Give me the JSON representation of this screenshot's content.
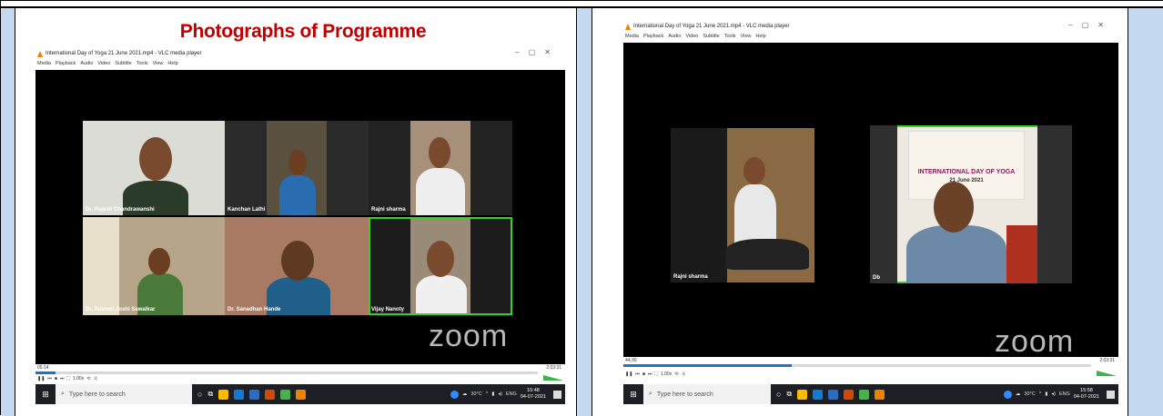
{
  "heading": "Photographs of Programme",
  "left_window": {
    "title": "International Day of Yoga 21 June 2021.mp4 - VLC media player",
    "menu": [
      "Media",
      "Playback",
      "Audio",
      "Video",
      "Subtitle",
      "Tools",
      "View",
      "Help"
    ],
    "participants": [
      {
        "name": "Dr. Rajesh Chandrawanshi"
      },
      {
        "name": "Kanchan Lathi"
      },
      {
        "name": "Rajni sharma"
      },
      {
        "name": "Dr. Rashmi Joshi Sawalkar"
      },
      {
        "name": "Dr. Sanadhan Hande"
      },
      {
        "name": "Vijay Nanoty"
      }
    ],
    "zoom_logo": "zoom",
    "elapsed": "05:14",
    "duration": "2:03:31",
    "progress": 0.04,
    "speed_label": "1.00x",
    "taskbar": {
      "search_placeholder": "Type here to search",
      "weather": "30°C",
      "lang": "ENG",
      "time": "15:48",
      "date": "04-07-2021"
    }
  },
  "right_window": {
    "title": "International Day of Yoga 21 June 2021.mp4 - VLC media player",
    "menu": [
      "Media",
      "Playback",
      "Audio",
      "Video",
      "Subtitle",
      "Tools",
      "View",
      "Help"
    ],
    "participants": [
      {
        "name": "Rajni sharma"
      },
      {
        "name": "Db"
      }
    ],
    "banner_title": "INTERNATIONAL DAY OF YOGA",
    "banner_sub": "21 June 2021",
    "zoom_logo": "zoom",
    "elapsed": "44:30",
    "duration": "2:03:31",
    "progress": 0.36,
    "speed_label": "1.00x",
    "taskbar": {
      "search_placeholder": "Type here to search",
      "weather": "30°C",
      "lang": "ENG",
      "time": "15:58",
      "date": "04-07-2021"
    }
  }
}
